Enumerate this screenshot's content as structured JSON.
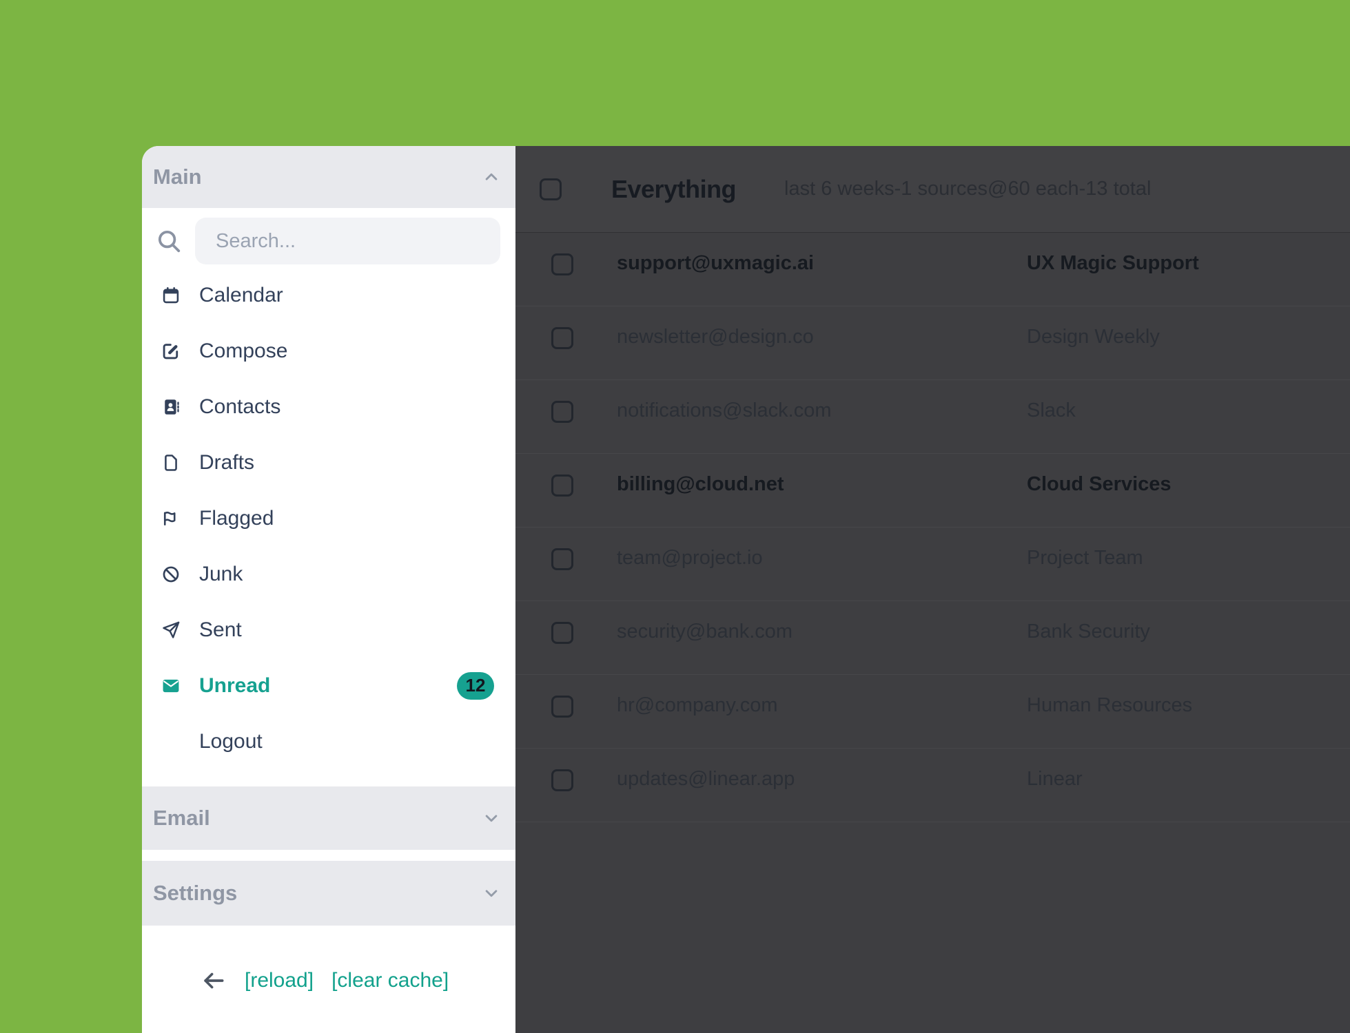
{
  "app": {
    "background_color": "#7cb543",
    "accent_teal": "#16a190",
    "dim_panel_color": "#3e3e41"
  },
  "sidebar": {
    "sections": {
      "main": {
        "label": "Main",
        "chevron": "chevron-up-icon"
      },
      "email": {
        "label": "Email",
        "chevron": "chevron-down-icon"
      },
      "settings": {
        "label": "Settings",
        "chevron": "chevron-down-icon"
      }
    },
    "search": {
      "placeholder": "Search..."
    },
    "items": [
      {
        "label": "Calendar",
        "icon": "calendar-icon"
      },
      {
        "label": "Compose",
        "icon": "compose-icon"
      },
      {
        "label": "Contacts",
        "icon": "contacts-icon"
      },
      {
        "label": "Drafts",
        "icon": "document-icon"
      },
      {
        "label": "Flagged",
        "icon": "flag-icon"
      },
      {
        "label": "Junk",
        "icon": "ban-icon"
      },
      {
        "label": "Sent",
        "icon": "paper-plane-icon"
      },
      {
        "label": "Unread",
        "icon": "envelope-icon",
        "badge": "12",
        "active": true
      },
      {
        "label": "Logout"
      }
    ],
    "footer": {
      "reload_label": "[reload]",
      "clear_cache_label": "[clear cache]"
    }
  },
  "mail": {
    "title": "Everything",
    "subtitle": "last 6 weeks-1 sources@60 each-13 total",
    "rows": [
      {
        "email": "support@uxmagic.ai",
        "name": "UX Magic Support",
        "unread": true
      },
      {
        "email": "newsletter@design.co",
        "name": "Design Weekly",
        "unread": false
      },
      {
        "email": "notifications@slack.com",
        "name": "Slack",
        "unread": false
      },
      {
        "email": "billing@cloud.net",
        "name": "Cloud Services",
        "unread": true
      },
      {
        "email": "team@project.io",
        "name": "Project Team",
        "unread": false
      },
      {
        "email": "security@bank.com",
        "name": "Bank Security",
        "unread": false
      },
      {
        "email": "hr@company.com",
        "name": "Human Resources",
        "unread": false
      },
      {
        "email": "updates@linear.app",
        "name": "Linear",
        "unread": false
      }
    ]
  }
}
